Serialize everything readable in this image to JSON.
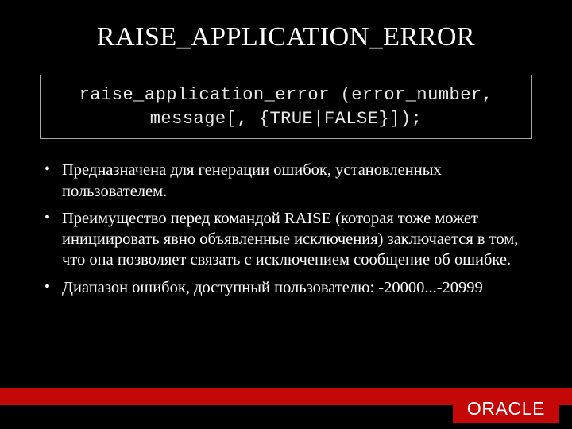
{
  "title": "RAISE_APPLICATION_ERROR",
  "code": {
    "line1": "raise_application_error (error_number,",
    "line2": "message[, {TRUE|FALSE}]);"
  },
  "bullets": [
    "Предназначена для генерации ошибок, установленных пользователем.",
    "Преимущество перед командой RAISE (которая тоже может инициировать явно объявленные исключения) заключается в том, что она позволяет связать с исключением сообщение об ошибке.",
    "Диапазон ошибок, доступный пользователю: -20000...-20999"
  ],
  "footer_brand": "ORACLE"
}
